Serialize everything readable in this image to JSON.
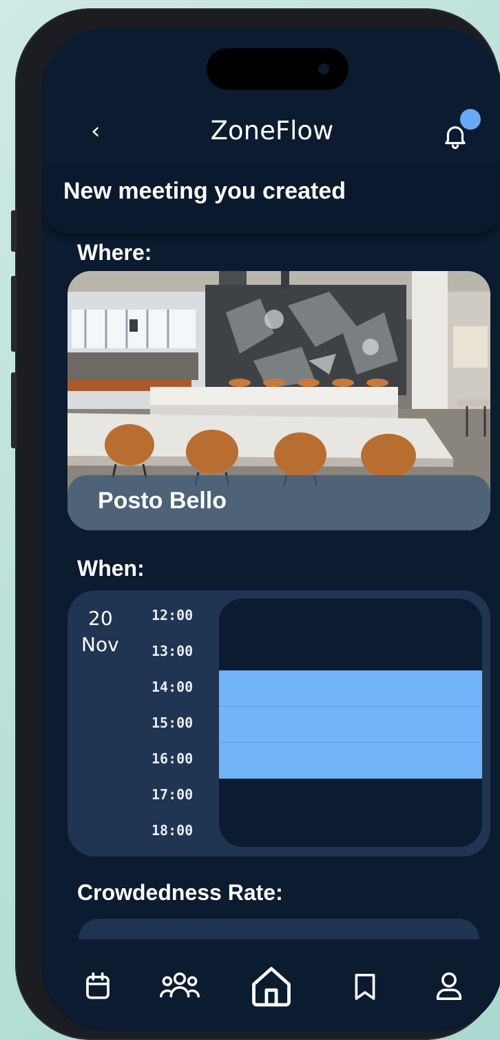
{
  "app": {
    "title": "ZoneFlow",
    "notification_count": ""
  },
  "header": {
    "subtitle": "New meeting you created"
  },
  "where": {
    "label": "Where:",
    "place_name": "Posto Bello"
  },
  "when": {
    "label": "When:",
    "day": "20",
    "month": "Nov",
    "times": [
      "12:00",
      "13:00",
      "14:00",
      "15:00",
      "16:00",
      "17:00",
      "18:00"
    ],
    "selected_range": [
      "14:00",
      "16:00"
    ]
  },
  "crowdedness": {
    "label": "Crowdedness Rate:"
  },
  "nav": {
    "items": [
      {
        "name": "calendar",
        "icon": "calendar-icon"
      },
      {
        "name": "groups",
        "icon": "people-icon"
      },
      {
        "name": "home",
        "icon": "home-icon"
      },
      {
        "name": "saved",
        "icon": "bookmark-icon"
      },
      {
        "name": "profile",
        "icon": "user-icon"
      }
    ],
    "active": "home"
  },
  "colors": {
    "background": "#0b1b30",
    "card": "#1f3552",
    "accent": "#73b4fb",
    "text": "#ffffff"
  }
}
